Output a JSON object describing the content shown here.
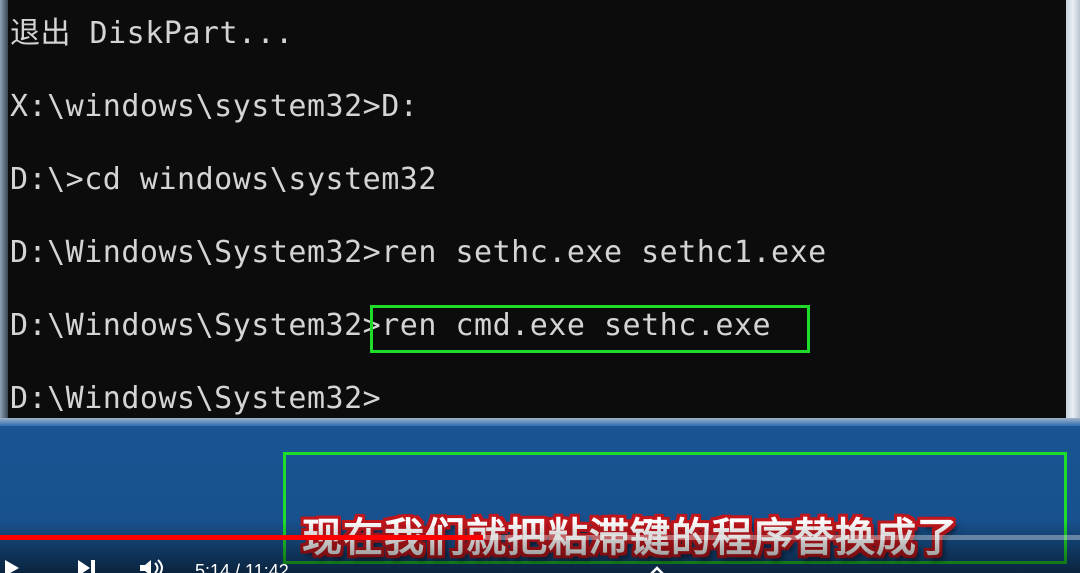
{
  "terminal": {
    "lines": [
      "退出 DiskPart...",
      "X:\\windows\\system32>D:",
      "D:\\>cd windows\\system32",
      "D:\\Windows\\System32>ren sethc.exe sethc1.exe",
      "D:\\Windows\\System32>ren cmd.exe sethc.exe",
      "D:\\Windows\\System32>"
    ]
  },
  "subtitle": {
    "text": "现在我们就把粘滞键的程序替换成了"
  },
  "player": {
    "time_display": "5:14 / 11:42",
    "progress_fraction": 0.447,
    "progress_color": "#ff0000",
    "icons": {
      "play": "play-icon",
      "next": "next-icon",
      "volume": "volume-icon",
      "chevron": "chevron-up-icon"
    }
  },
  "colors": {
    "highlight_box": "#1fdc2a",
    "subtitle_outline": "#c0161c",
    "terminal_bg": "#0c0c0c",
    "terminal_text": "#d4d4d4"
  }
}
